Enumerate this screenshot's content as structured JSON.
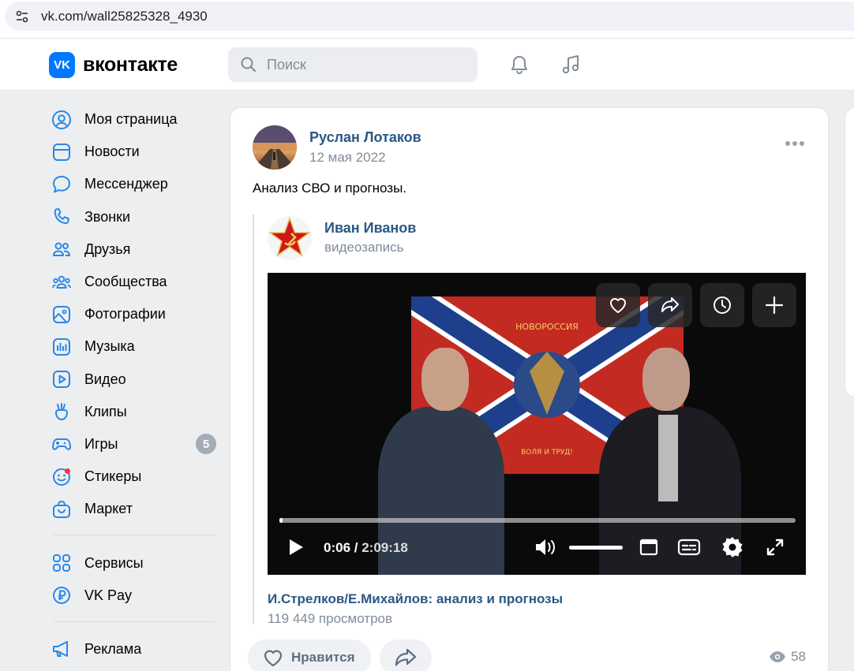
{
  "browser": {
    "url": "vk.com/wall25825328_4930"
  },
  "header": {
    "logo_text": "вконтакте",
    "logo_mark": "VK",
    "search_placeholder": "Поиск"
  },
  "sidebar": {
    "items": [
      {
        "label": "Моя страница",
        "icon": "user-circle-icon"
      },
      {
        "label": "Новости",
        "icon": "newsfeed-icon"
      },
      {
        "label": "Мессенджер",
        "icon": "message-icon"
      },
      {
        "label": "Звонки",
        "icon": "phone-icon"
      },
      {
        "label": "Друзья",
        "icon": "friends-icon"
      },
      {
        "label": "Сообщества",
        "icon": "communities-icon"
      },
      {
        "label": "Фотографии",
        "icon": "photo-icon"
      },
      {
        "label": "Музыка",
        "icon": "music-icon"
      },
      {
        "label": "Видео",
        "icon": "video-icon"
      },
      {
        "label": "Клипы",
        "icon": "clips-icon"
      },
      {
        "label": "Игры",
        "icon": "games-icon",
        "badge": "5"
      },
      {
        "label": "Стикеры",
        "icon": "stickers-icon"
      },
      {
        "label": "Маркет",
        "icon": "market-icon"
      }
    ],
    "items2": [
      {
        "label": "Сервисы",
        "icon": "services-icon"
      },
      {
        "label": "VK Pay",
        "icon": "vkpay-icon"
      }
    ],
    "items3": [
      {
        "label": "Реклама",
        "icon": "ads-icon"
      }
    ]
  },
  "post": {
    "author": "Руслан Лотаков",
    "date": "12 мая 2022",
    "text": "Анализ СВО и прогнозы.",
    "repost": {
      "author": "Иван Иванов",
      "subtitle": "видеозапись",
      "video": {
        "current_time": "0:06",
        "duration": "2:09:18",
        "progress_fraction": 0.0008,
        "volume_fraction": 1.0,
        "title": "И.Стрелков/Е.Михайлов: анализ и прогнозы",
        "views": "119 449 просмотров"
      }
    },
    "like_label": "Нравится",
    "view_count": "58"
  },
  "colors": {
    "accent": "#0077ff",
    "link": "#2a5885",
    "muted": "#818c99",
    "background": "#edeef0"
  }
}
